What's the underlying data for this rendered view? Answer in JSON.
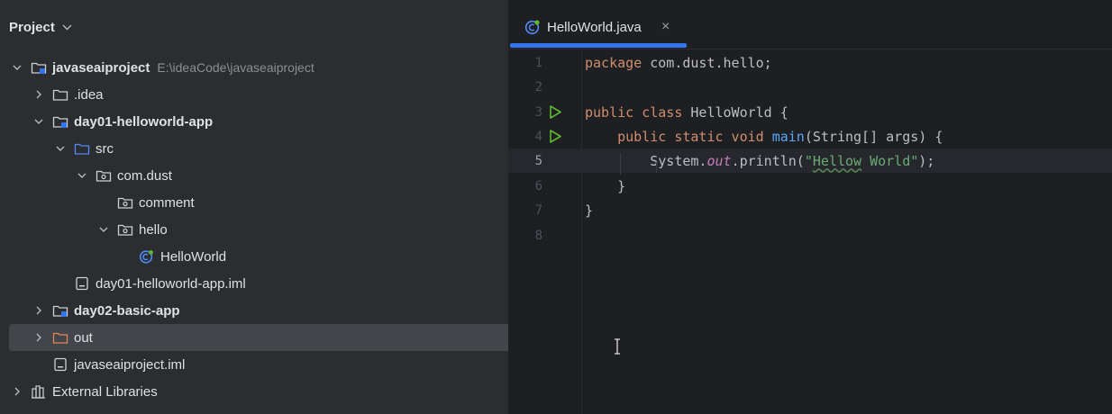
{
  "project_panel": {
    "title": "Project",
    "tree": [
      {
        "label": "javaseaiproject",
        "hint": "E:\\ideaCode\\javaseaiproject",
        "expanded": true,
        "icon": "module-folder-icon"
      },
      {
        "label": ".idea",
        "expanded": false,
        "icon": "folder-icon"
      },
      {
        "label": "day01-helloworld-app",
        "expanded": true,
        "icon": "module-folder-icon"
      },
      {
        "label": "src",
        "expanded": true,
        "icon": "source-folder-icon"
      },
      {
        "label": "com.dust",
        "expanded": true,
        "icon": "package-icon"
      },
      {
        "label": "comment",
        "icon": "package-icon"
      },
      {
        "label": "hello",
        "expanded": true,
        "icon": "package-icon"
      },
      {
        "label": "HelloWorld",
        "icon": "java-class-icon"
      },
      {
        "label": "day01-helloworld-app.iml",
        "icon": "iml-file-icon"
      },
      {
        "label": "day02-basic-app",
        "expanded": false,
        "icon": "module-folder-icon"
      },
      {
        "label": "out",
        "expanded": false,
        "icon": "excluded-folder-icon"
      },
      {
        "label": "javaseaiproject.iml",
        "icon": "iml-file-icon"
      },
      {
        "label": "External Libraries",
        "expanded": false,
        "icon": "libraries-icon"
      }
    ]
  },
  "editor": {
    "tab": {
      "label": "HelloWorld.java",
      "close": "×"
    },
    "line_numbers": [
      "1",
      "2",
      "3",
      "4",
      "5",
      "6",
      "7",
      "8"
    ],
    "code": {
      "l1_kw": "package",
      "l1_rest": " com.dust.hello;",
      "l3_kw": "public class",
      "l3_rest": " HelloWorld {",
      "l4_indent": "    ",
      "l4_kw": "public static void",
      "l4_sp": " ",
      "l4_fn": "main",
      "l4_rest": "(String[] args) {",
      "l5_pre": "        System.",
      "l5_static": "out",
      "l5_mid": ".println(",
      "l5_q1": "\"",
      "l5_typo": "Hellow",
      "l5_str": " World\"",
      "l5_end": ");",
      "l6": "    }",
      "l7": "}"
    },
    "current_line": "5"
  },
  "colors": {
    "panel_bg": "#2b2d30",
    "editor_bg": "#1e1f22",
    "accent": "#3574f0",
    "keyword": "#cf8e6d",
    "string": "#6aab73",
    "function": "#56a8f5",
    "run_green": "#5fb832"
  }
}
